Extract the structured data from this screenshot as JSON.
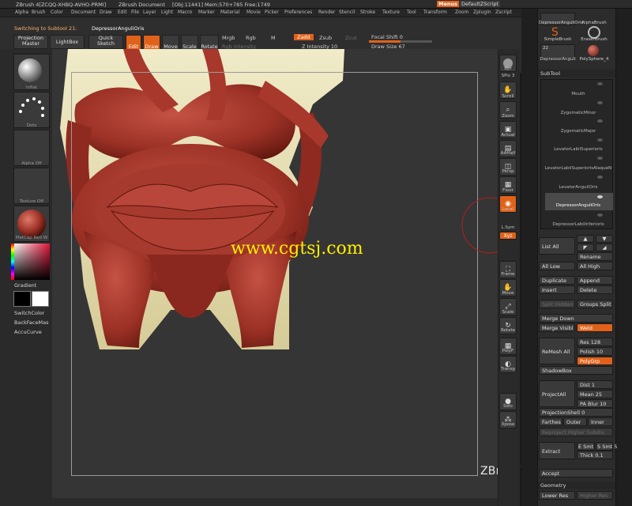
{
  "titlebar": {
    "app": "ZBrush 4[ZCQQ-XHBQ-AVHO-PRMI]",
    "doc": "ZBrush Document",
    "stats": "[Obj:11441] Mem:570+785 Free:1749",
    "menus_button": "Menus",
    "script_button": "DefaultZScript"
  },
  "menubar": {
    "items": [
      "Alpha",
      "Brush",
      "Color",
      "Document",
      "Draw",
      "Edit",
      "File",
      "Layer",
      "Light",
      "Macro",
      "Marker",
      "Material",
      "Movie",
      "Picker",
      "Preferences",
      "Render",
      "Stencil",
      "Stroke",
      "Texture",
      "Tool",
      "Transform",
      "Zoom",
      "Zplugin",
      "Zscript"
    ]
  },
  "toolbar": {
    "status": "Switching to Subtool 21:",
    "subtool_name": "DepressorAnguliOris",
    "projection_master": "Projection Master",
    "lightbox": "LightBox",
    "quick_sketch": "Quick Sketch",
    "edit": "Edit",
    "draw": "Draw",
    "move": "Move",
    "scale": "Scale",
    "rotate": "Rotate",
    "mrgb": "Mrgb",
    "rgb": "Rgb",
    "m": "M",
    "rgb_intensity": "Rgb Intensity",
    "zadd": "Zadd",
    "zsub": "Zsub",
    "zcut": "Zcut",
    "z_intensity_label": "Z Intensity",
    "z_intensity_value": "10",
    "focal_shift_label": "Focal Shift",
    "focal_shift_value": "0",
    "draw_size_label": "Draw Size",
    "draw_size_value": "67"
  },
  "leftshelf": {
    "brush_label": "Inflat",
    "stroke_label": "Dots",
    "alpha_label": "Alpha Off",
    "texture_label": "Texture Off",
    "material_label": "MatCap Red W",
    "gradient": "Gradient",
    "switch_color": "SwitchColor",
    "back_face_mask": "BackFaceMas",
    "accu_curve": "AccuCurve"
  },
  "rightshelf": {
    "bpr": "Bpr",
    "spix_label": "SPix",
    "spix_value": "3",
    "scroll": "Scroll",
    "zoom": "Zoom",
    "actual": "Actual",
    "aahalf": "AAHalf",
    "persp": "Persp",
    "floor": "Floor",
    "local": "Local",
    "lsym": "L.Sym",
    "xyz": "Xyz",
    "frame": "Frame",
    "move": "Move",
    "scale": "Scale",
    "rotate": "Rotate",
    "polyf": "PolyF",
    "transp": "Transp",
    "solo": "Solo",
    "xpose": "Xpose"
  },
  "panel": {
    "brushes": [
      "DepressorAnguliOris",
      "AlphaBrush",
      "SimpleBrush",
      "EraserBrush",
      "DepressorAnguli",
      "PolySphere_4"
    ],
    "brush_count": "22",
    "subtool_header": "SubTool",
    "subtools": [
      "Mouth",
      "ZygomaticMinor",
      "ZygomaticMajor",
      "LevatorLabiiSuperioris",
      "LevatorLabiiSuperiorisAlaqueN",
      "LevatorAnguliOris",
      "DepressorAnguliOris",
      "DepressorLabiiInferioris"
    ],
    "list_all": "List All",
    "rename": "Rename",
    "all_low": "All Low",
    "all_high": "All High",
    "duplicate": "Duplicate",
    "append": "Append",
    "insert": "Insert",
    "delete": "Delete",
    "split_hidden": "Split Hidden",
    "groups_split": "Groups Split",
    "merge_down": "Merge Down",
    "merge_visible": "Merge Visibl",
    "weld": "Weld",
    "remesh_all": "ReMesh All",
    "res_label": "Res",
    "res_value": "128",
    "polish_label": "Polish",
    "polish_value": "10",
    "polygrp": "PolyGrp",
    "shadowbox": "ShadowBox",
    "project_all": "ProjectAll",
    "dist_label": "Dist",
    "dist_value": "1",
    "mean_label": "Mean",
    "mean_value": "25",
    "pa_blur_label": "PA Blur",
    "pa_blur_value": "10",
    "projection_shell_label": "ProjectionShell",
    "projection_shell_value": "0",
    "farthest": "Farthes",
    "outer": "Outer",
    "inner": "Inner",
    "reproject_higher_subdiv": "Reproject Higher Subdiv",
    "extract": "Extract",
    "e_smt_label": "E Smt",
    "e_smt_value": "5",
    "s_smt_label": "S Smt",
    "s_smt_value": "5",
    "thick_label": "Thick",
    "thick_value": "0.1",
    "accept": "Accept",
    "geometry": "Geometry",
    "lower_res": "Lower Res",
    "higher_res": "Higher Res"
  },
  "overlay": {
    "watermark": "www.cgtsj.com",
    "brand": "ZBrushWorkshops"
  },
  "colors": {
    "accent": "#e0621a",
    "muscle": "#9c3126",
    "bone": "#e9e2b8",
    "canvas": "#353535"
  }
}
